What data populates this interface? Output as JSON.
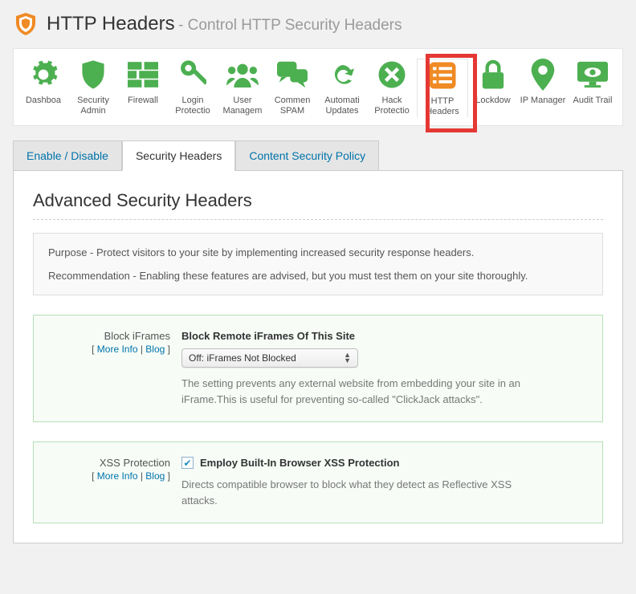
{
  "header": {
    "title": "HTTP Headers",
    "subtitle": "- Control HTTP Security Headers"
  },
  "nav": [
    {
      "label": "Dashboa"
    },
    {
      "label": "Security Admin"
    },
    {
      "label": "Firewall"
    },
    {
      "label": "Login Protectio"
    },
    {
      "label": "User Managem"
    },
    {
      "label": "Commen SPAM"
    },
    {
      "label": "Automati Updates"
    },
    {
      "label": "Hack Protectio"
    },
    {
      "label": "HTTP Headers"
    },
    {
      "label": "Lockdow"
    },
    {
      "label": "IP Manager"
    },
    {
      "label": "Audit Trail"
    }
  ],
  "tabs": [
    {
      "label": "Enable / Disable"
    },
    {
      "label": "Security Headers"
    },
    {
      "label": "Content Security Policy"
    }
  ],
  "section_title": "Advanced Security Headers",
  "info": {
    "purpose": "Purpose - Protect visitors to your site by implementing increased security response headers.",
    "recommendation": "Recommendation - Enabling these features are advised, but you must test them on your site thoroughly."
  },
  "links": {
    "more": "More Info",
    "blog": "Blog"
  },
  "settings": {
    "iframes": {
      "name": "Block iFrames",
      "field_title": "Block Remote iFrames Of This Site",
      "selected": "Off: iFrames Not Blocked",
      "desc": "The setting prevents any external website from embedding your site in an iFrame.This is useful for preventing so-called \"ClickJack attacks\"."
    },
    "xss": {
      "name": "XSS Protection",
      "field_title": "Employ Built-In Browser XSS Protection",
      "desc": "Directs compatible browser to block what they detect as Reflective XSS attacks."
    }
  }
}
